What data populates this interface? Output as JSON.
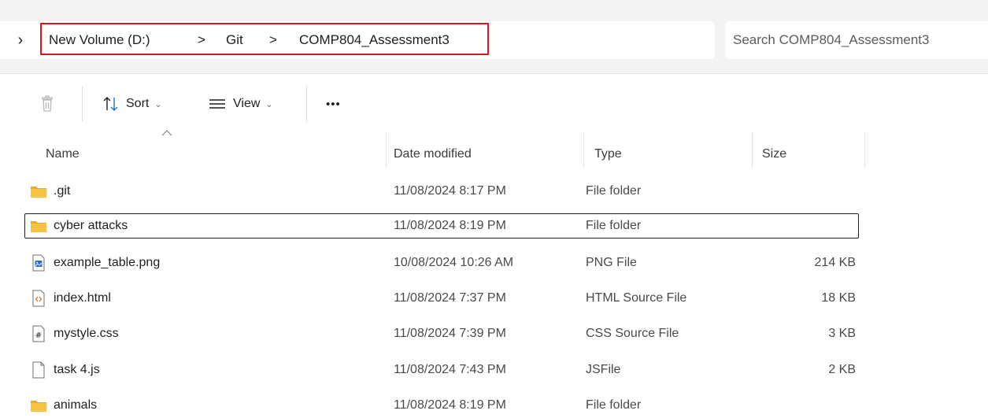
{
  "address_bar": {
    "crumbs": [
      "New Volume (D:)",
      "Git",
      "COMP804_Assessment3"
    ],
    "separator": ">"
  },
  "search": {
    "placeholder": "Search COMP804_Assessment3"
  },
  "toolbar": {
    "sort_label": "Sort",
    "view_label": "View",
    "more_label": "•••"
  },
  "columns": {
    "name": "Name",
    "date": "Date modified",
    "type": "Type",
    "size": "Size"
  },
  "files": [
    {
      "name": ".git",
      "date": "11/08/2024 8:17 PM",
      "type": "File folder",
      "size": "",
      "icon": "folder-icon"
    },
    {
      "name": "cyber attacks",
      "date": "11/08/2024 8:19 PM",
      "type": "File folder",
      "size": "",
      "icon": "folder-icon"
    },
    {
      "name": "example_table.png",
      "date": "10/08/2024 10:26 AM",
      "type": "PNG File",
      "size": "214 KB",
      "icon": "image-file-icon"
    },
    {
      "name": "index.html",
      "date": "11/08/2024 7:37 PM",
      "type": "HTML Source File",
      "size": "18 KB",
      "icon": "html-file-icon"
    },
    {
      "name": "mystyle.css",
      "date": "11/08/2024 7:39 PM",
      "type": "CSS Source File",
      "size": "3 KB",
      "icon": "css-file-icon"
    },
    {
      "name": "task 4.js",
      "date": "11/08/2024 7:43 PM",
      "type": "JSFile",
      "size": "2 KB",
      "icon": "blank-file-icon"
    },
    {
      "name": "animals",
      "date": "11/08/2024 8:19 PM",
      "type": "File folder",
      "size": "",
      "icon": "folder-icon"
    }
  ],
  "colors": {
    "highlight_border": "#e0161e",
    "folder": "#f6c343",
    "accent_blue": "#2a6bd1"
  }
}
